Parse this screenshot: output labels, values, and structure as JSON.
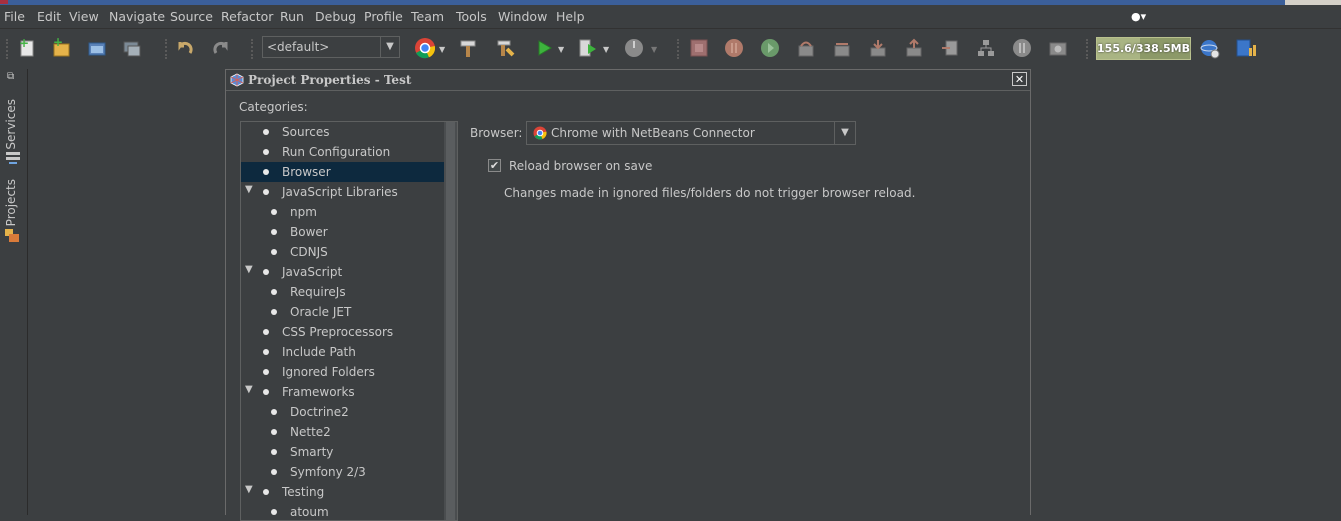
{
  "menu": {
    "items": [
      "File",
      "Edit",
      "View",
      "Navigate",
      "Source",
      "Refactor",
      "Run",
      "Debug",
      "Profile",
      "Team",
      "Tools",
      "Window",
      "Help"
    ]
  },
  "toolbar": {
    "config_select": "<default>",
    "memory": {
      "label": "155.6/338.5MB",
      "used_fraction": 0.46
    }
  },
  "side_tabs": [
    "Services",
    "Projects"
  ],
  "dialog": {
    "title": "Project Properties - Test",
    "categories_label": "Categories:",
    "categories": [
      {
        "label": "Sources",
        "level": 0,
        "expanded": null,
        "selected": false
      },
      {
        "label": "Run Configuration",
        "level": 0,
        "expanded": null,
        "selected": false
      },
      {
        "label": "Browser",
        "level": 0,
        "expanded": null,
        "selected": true
      },
      {
        "label": "JavaScript Libraries",
        "level": 0,
        "expanded": true,
        "selected": false
      },
      {
        "label": "npm",
        "level": 1,
        "expanded": null,
        "selected": false
      },
      {
        "label": "Bower",
        "level": 1,
        "expanded": null,
        "selected": false
      },
      {
        "label": "CDNJS",
        "level": 1,
        "expanded": null,
        "selected": false
      },
      {
        "label": "JavaScript",
        "level": 0,
        "expanded": true,
        "selected": false
      },
      {
        "label": "RequireJs",
        "level": 1,
        "expanded": null,
        "selected": false
      },
      {
        "label": "Oracle JET",
        "level": 1,
        "expanded": null,
        "selected": false
      },
      {
        "label": "CSS Preprocessors",
        "level": 0,
        "expanded": null,
        "selected": false
      },
      {
        "label": "Include Path",
        "level": 0,
        "expanded": null,
        "selected": false
      },
      {
        "label": "Ignored Folders",
        "level": 0,
        "expanded": null,
        "selected": false
      },
      {
        "label": "Frameworks",
        "level": 0,
        "expanded": true,
        "selected": false
      },
      {
        "label": "Doctrine2",
        "level": 1,
        "expanded": null,
        "selected": false
      },
      {
        "label": "Nette2",
        "level": 1,
        "expanded": null,
        "selected": false
      },
      {
        "label": "Smarty",
        "level": 1,
        "expanded": null,
        "selected": false
      },
      {
        "label": "Symfony 2/3",
        "level": 1,
        "expanded": null,
        "selected": false
      },
      {
        "label": "Testing",
        "level": 0,
        "expanded": true,
        "selected": false
      },
      {
        "label": "atoum",
        "level": 1,
        "expanded": null,
        "selected": false
      }
    ],
    "browser_label": "Browser:",
    "browser_value": "Chrome with NetBeans Connector",
    "reload_label": "Reload browser on save",
    "reload_checked": true,
    "hint": "Changes made in ignored files/folders do not trigger browser reload."
  }
}
